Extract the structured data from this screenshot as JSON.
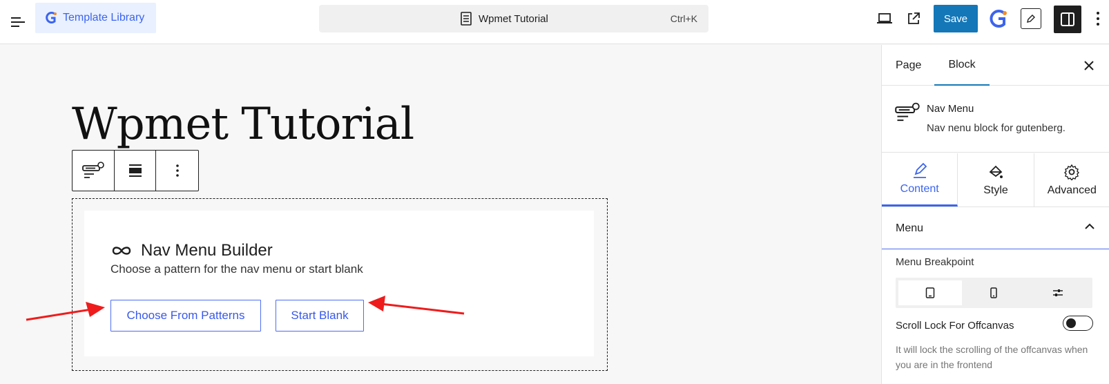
{
  "topbar": {
    "template_library_label": "Template Library",
    "document_title": "Wpmet Tutorial",
    "shortcut": "Ctrl+K",
    "save_label": "Save"
  },
  "canvas": {
    "post_title": "Wpmet Tutorial",
    "builder": {
      "title": "Nav Menu Builder",
      "subtitle": "Choose a pattern for the nav menu or start blank",
      "choose_patterns_label": "Choose From Patterns",
      "start_blank_label": "Start Blank"
    }
  },
  "sidebar": {
    "tabs": [
      "Page",
      "Block"
    ],
    "active_tab": "Block",
    "block_name": "Nav Menu",
    "block_description": "Nav nenu block for gutenberg.",
    "inner_tabs": [
      "Content",
      "Style",
      "Advanced"
    ],
    "active_inner_tab": "Content",
    "panel_title": "Menu",
    "menu_breakpoint_label": "Menu Breakpoint",
    "scroll_lock_label": "Scroll Lock For Offcanvas",
    "scroll_lock_enabled": false,
    "help_text": "It will lock the scrolling of the offcanvas when you are in the frontend"
  },
  "colors": {
    "accent": "#3b64ee",
    "save": "#1477b8",
    "arrow": "#ee1c1c"
  }
}
